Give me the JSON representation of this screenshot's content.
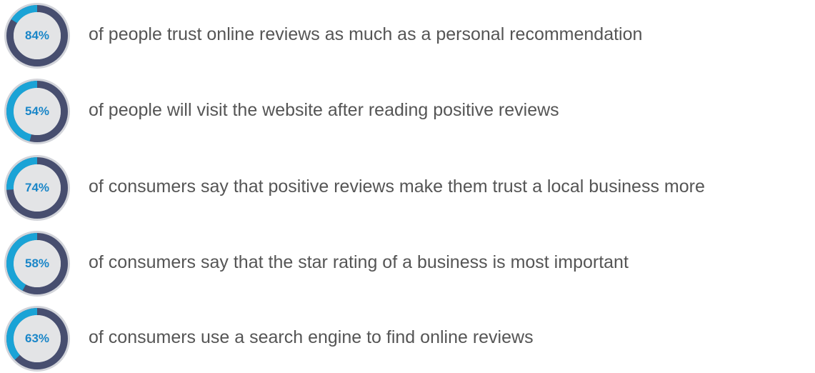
{
  "colors": {
    "ring_track": "#474e6f",
    "ring_fill": "#1aa3d6",
    "outer_ring": "#d2d4da",
    "inner_disc": "#e3e4e6",
    "percent_text": "#1a86c8",
    "body_text": "#555555"
  },
  "chart_data": {
    "type": "donut",
    "items": [
      {
        "value": 84,
        "label": "84%",
        "text": "of people trust online reviews as much as a personal recommendation"
      },
      {
        "value": 54,
        "label": "54%",
        "text": "of people will visit the website after reading positive reviews"
      },
      {
        "value": 74,
        "label": "74%",
        "text": "of consumers say that positive reviews make them trust a local business more"
      },
      {
        "value": 58,
        "label": "58%",
        "text": "of consumers say that the star rating of a business is most important"
      },
      {
        "value": 63,
        "label": "63%",
        "text": "of consumers use a search engine to find online reviews"
      }
    ]
  }
}
